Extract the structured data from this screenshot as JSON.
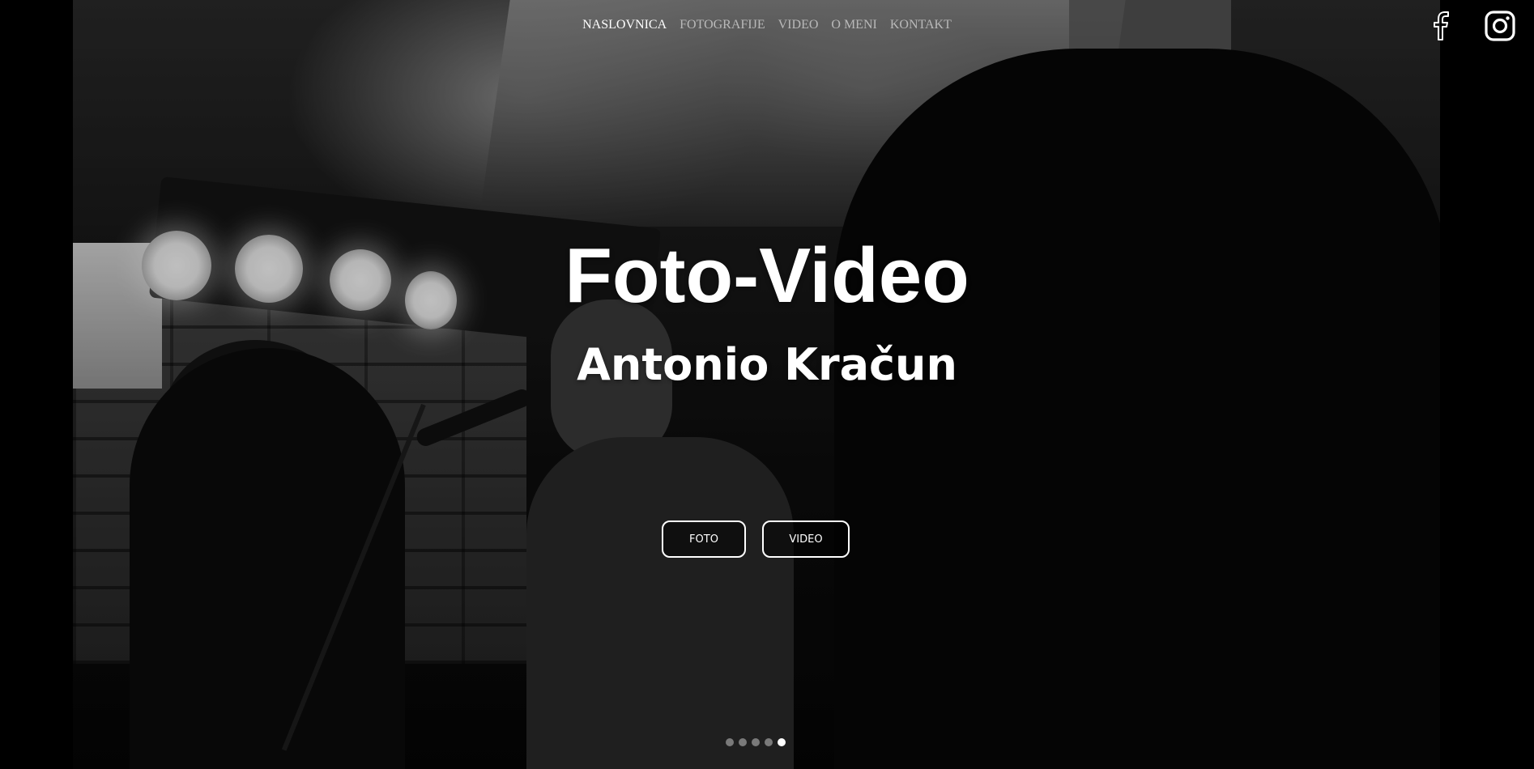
{
  "nav": {
    "items": [
      {
        "label": "NASLOVNICA",
        "active": true
      },
      {
        "label": "FOTOGRAFIJE",
        "active": false
      },
      {
        "label": "VIDEO",
        "active": false
      },
      {
        "label": "O MENI",
        "active": false
      },
      {
        "label": "KONTAKT",
        "active": false
      }
    ]
  },
  "social": {
    "icons": [
      "facebook-icon",
      "instagram-icon"
    ]
  },
  "hero": {
    "title": "Foto-Video",
    "subtitle": "Antonio Kračun",
    "buttons": {
      "foto_label": "FOTO",
      "video_label": "VIDEO"
    },
    "slides": {
      "count": 5,
      "active_index": 4
    }
  },
  "colors": {
    "background": "#000000",
    "text": "#ffffff",
    "nav_inactive": "#b9b9b9",
    "dot_inactive": "#7a7a7a"
  }
}
